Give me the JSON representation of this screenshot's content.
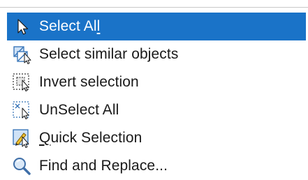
{
  "menu": {
    "items": [
      {
        "label_main": "Select Al",
        "label_underlined": "l",
        "icon": "cursor-arrow-icon",
        "selected": true
      },
      {
        "label": "Select similar objects",
        "icon": "select-similar-icon",
        "selected": false
      },
      {
        "label": "Invert selection",
        "icon": "invert-selection-icon",
        "selected": false
      },
      {
        "label": "UnSelect All",
        "icon": "unselect-all-icon",
        "selected": false
      },
      {
        "label_underlined": "Q",
        "label_rest": "uick Selection",
        "icon": "quick-selection-icon",
        "selected": false
      },
      {
        "label": "Find and Replace...",
        "icon": "magnifier-icon",
        "selected": false
      }
    ]
  },
  "colors": {
    "highlight": "#1a73c8",
    "text": "#1a1a1a",
    "highlight_text": "#ffffff",
    "icon_blue": "#2f6fb5"
  }
}
